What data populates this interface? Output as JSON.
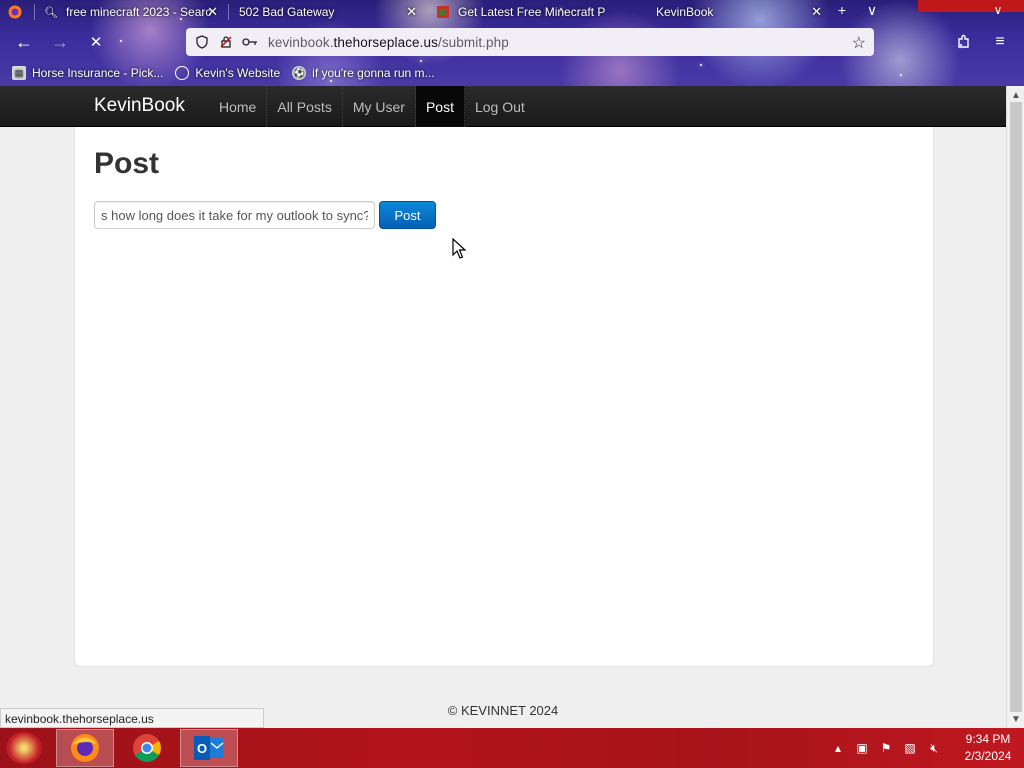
{
  "browser": {
    "tabs": [
      {
        "title": "free minecraft 2023 - Searc",
        "icon": "search-icon"
      },
      {
        "title": "502 Bad Gateway",
        "icon": ""
      },
      {
        "title": "Get Latest Free Minecraft P",
        "icon": "minecraft-icon"
      },
      {
        "title": "KevinBook",
        "icon": ""
      }
    ],
    "url_prefix": "kevinbook.",
    "url_domain": "thehorseplace.us",
    "url_path": "/submit.php",
    "bookmarks": [
      {
        "label": "Horse Insurance - Pick...",
        "icon": "page-icon"
      },
      {
        "label": "Kevin's Website",
        "icon": "globe-icon"
      },
      {
        "label": "if you're gonna run m...",
        "icon": "soccer-icon"
      }
    ],
    "status_url": "kevinbook.thehorseplace.us"
  },
  "site": {
    "brand": "KevinBook",
    "nav": [
      {
        "label": "Home",
        "active": false
      },
      {
        "label": "All Posts",
        "active": false
      },
      {
        "label": "My User",
        "active": false
      },
      {
        "label": "Post",
        "active": true
      },
      {
        "label": "Log Out",
        "active": false
      }
    ],
    "page_title": "Post",
    "post_input_value": "s how long does it take for my outlook to sync?",
    "post_button_label": "Post",
    "footer": "© KEVINNET 2024"
  },
  "taskbar": {
    "apps": [
      "firefox-icon",
      "chrome-icon",
      "outlook-icon"
    ],
    "time": "9:34 PM",
    "date": "2/3/2024"
  },
  "colors": {
    "navbar": "#1a1a1a",
    "post_button": "#0a7ccf",
    "taskbar": "#b3141b"
  }
}
